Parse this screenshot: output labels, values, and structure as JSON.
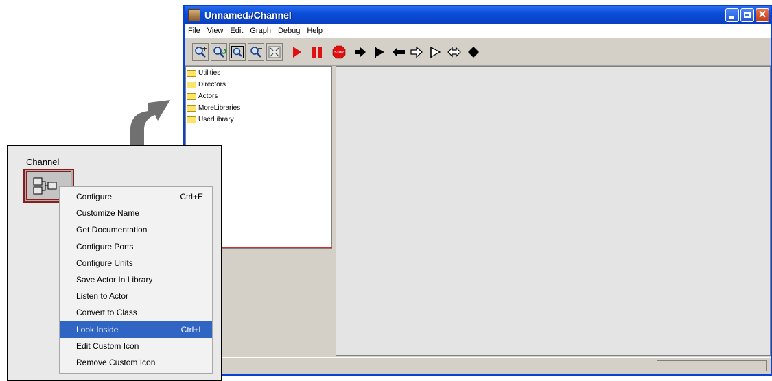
{
  "window": {
    "title": "Unnamed#Channel",
    "menu": [
      "File",
      "View",
      "Edit",
      "Graph",
      "Debug",
      "Help"
    ],
    "toolbar": [
      {
        "name": "zoom-in-icon"
      },
      {
        "name": "zoom-reset-icon"
      },
      {
        "name": "zoom-fit-icon"
      },
      {
        "name": "zoom-out-icon"
      },
      {
        "name": "fullscreen-icon"
      },
      {
        "name": "run-icon"
      },
      {
        "name": "pause-icon"
      },
      {
        "name": "stop-icon"
      },
      {
        "name": "step-icon"
      },
      {
        "name": "flag-icon"
      },
      {
        "name": "step-back-icon"
      },
      {
        "name": "arrow-outline-icon"
      },
      {
        "name": "flag-outline-icon"
      },
      {
        "name": "double-arrow-outline-icon"
      },
      {
        "name": "diamond-icon"
      }
    ],
    "library": [
      "Utilities",
      "Directors",
      "Actors",
      "MoreLibraries",
      "UserLibrary"
    ]
  },
  "inset": {
    "actor_label": "Channel",
    "context_menu": [
      {
        "label": "Configure",
        "shortcut": "Ctrl+E"
      },
      {
        "label": "Customize Name",
        "shortcut": ""
      },
      {
        "label": "Get Documentation",
        "shortcut": ""
      },
      {
        "label": "Configure Ports",
        "shortcut": ""
      },
      {
        "label": "Configure Units",
        "shortcut": ""
      },
      {
        "label": "Save Actor In Library",
        "shortcut": ""
      },
      {
        "label": "Listen to Actor",
        "shortcut": ""
      },
      {
        "label": "Convert to Class",
        "shortcut": ""
      },
      {
        "label": "Look Inside",
        "shortcut": "Ctrl+L",
        "selected": true
      },
      {
        "label": "Edit Custom Icon",
        "shortcut": ""
      },
      {
        "label": "Remove Custom Icon",
        "shortcut": ""
      }
    ]
  },
  "colors": {
    "titlebar": "#0a4ed9",
    "menu_highlight": "#3165c4",
    "run_red": "#e01010",
    "arrow_gray": "#707070"
  }
}
